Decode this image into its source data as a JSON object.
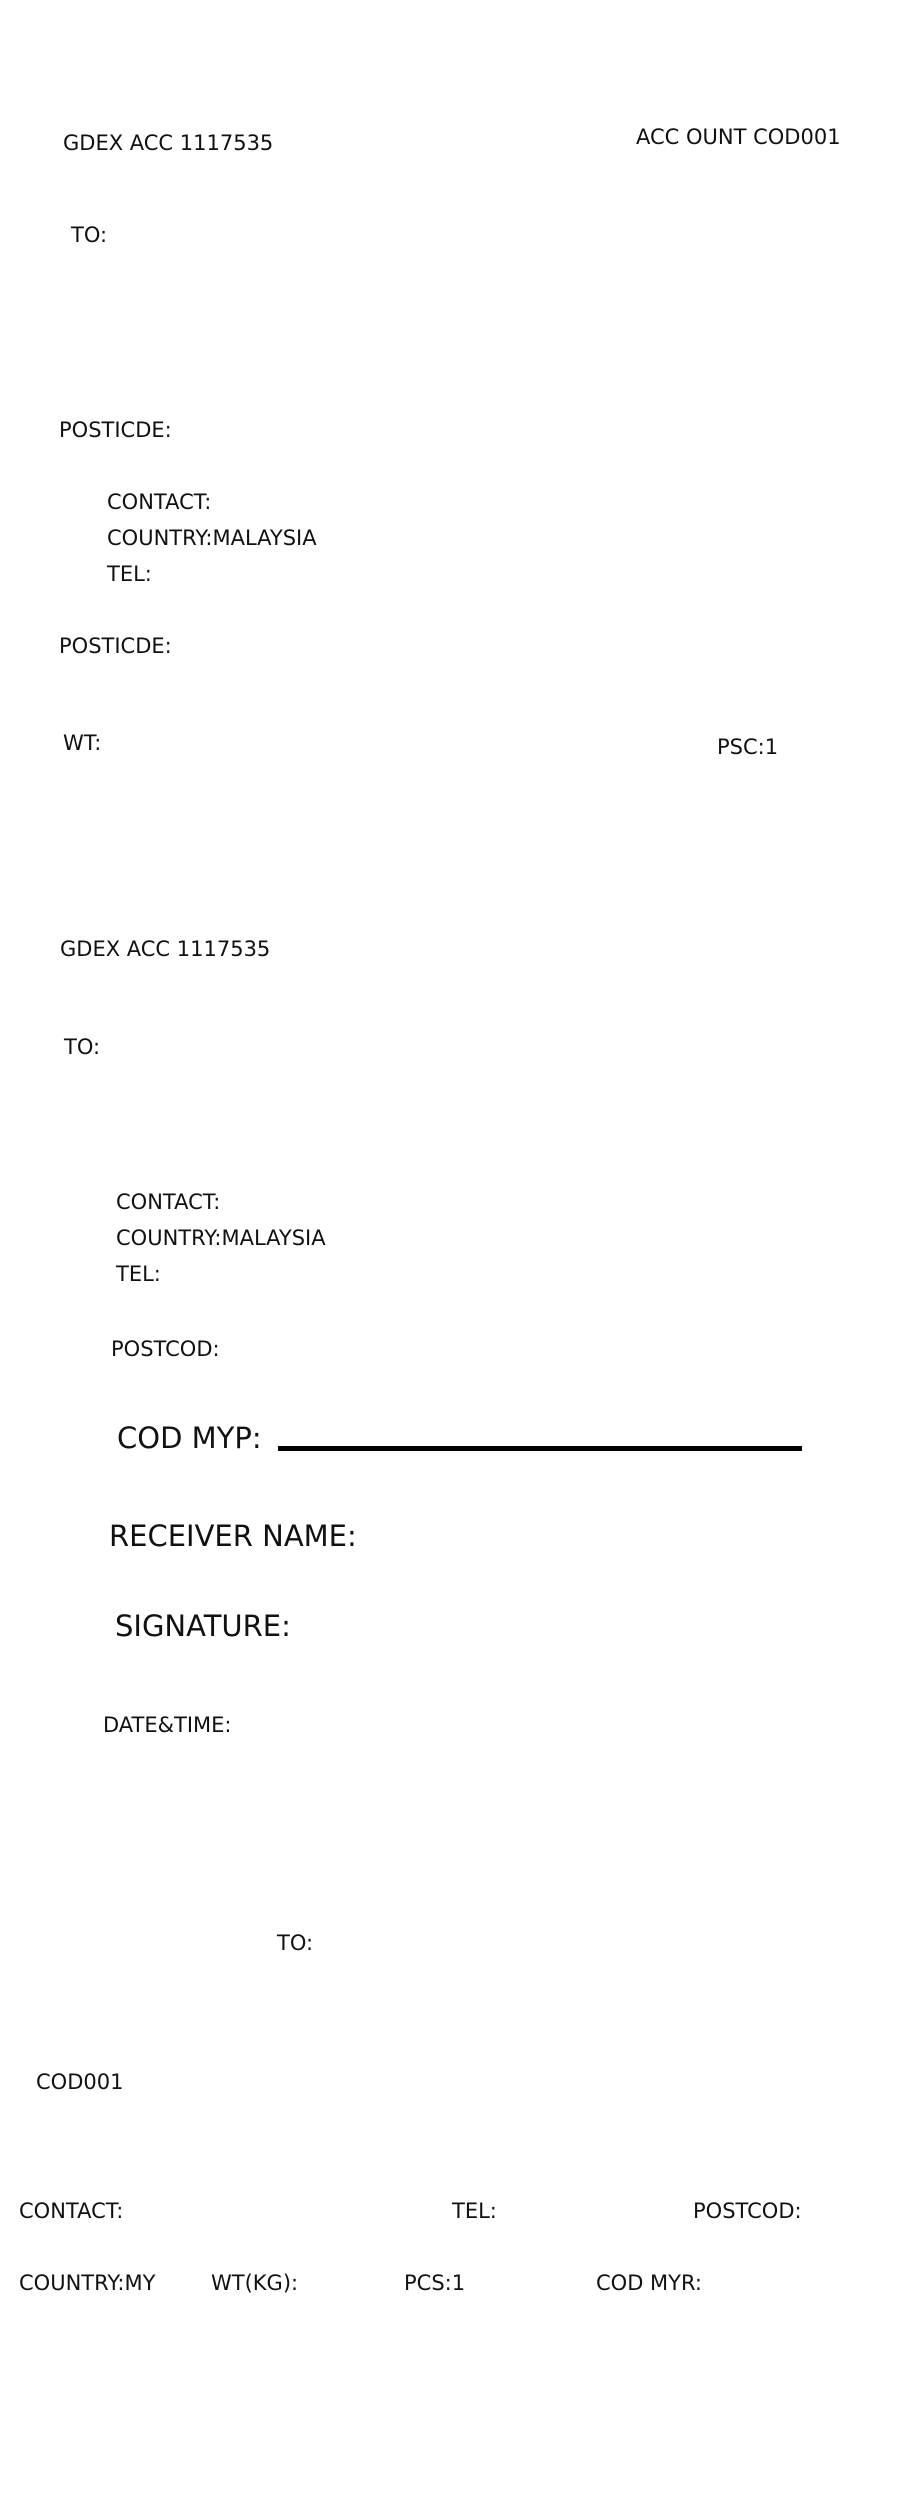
{
  "label1": {
    "account": "GDEX ACC 1117535",
    "account_code": "ACC OUNT COD001",
    "to": "TO:",
    "postcode_1": "POSTICDE:",
    "contact": "CONTACT:",
    "country": "COUNTRY:MALAYSIA",
    "tel": "TEL:",
    "postcode_2": "POSTICDE:",
    "weight": "WT:",
    "pieces": "PSC:1"
  },
  "label2": {
    "account": "GDEX ACC 1117535",
    "to": "TO:",
    "contact": "CONTACT:",
    "country": "COUNTRY:MALAYSIA",
    "tel": "TEL:",
    "postcode": "POSTCOD:",
    "cod": "COD MYP:",
    "receiver_name": "RECEIVER NAME:",
    "signature": "SIGNATURE:",
    "date_time": "DATE&TIME:"
  },
  "label3": {
    "to": "TO:",
    "code": "COD001",
    "contact": "CONTACT:",
    "tel": "TEL:",
    "postcode": "POSTCOD:",
    "country": "COUNTRY:MY",
    "weight": "WT(KG):",
    "pieces": "PCS:1",
    "cod": "COD MYR:"
  }
}
